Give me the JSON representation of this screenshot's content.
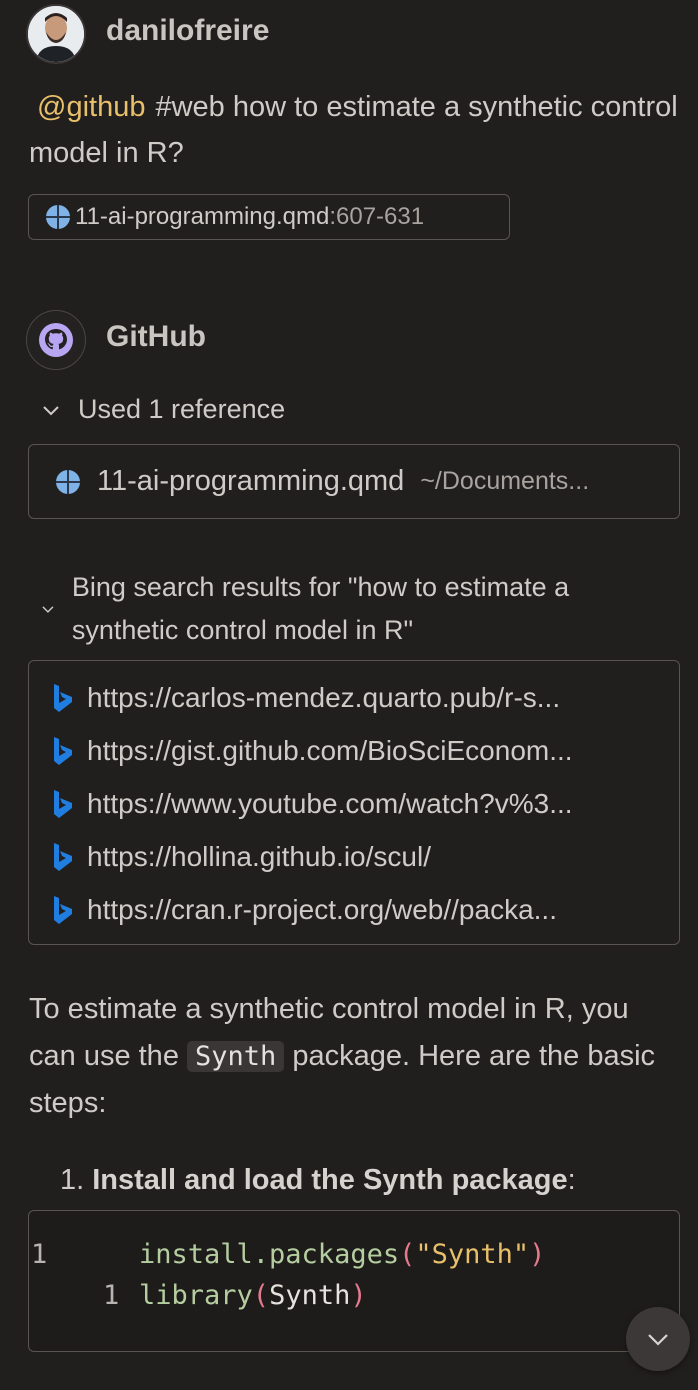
{
  "user": {
    "name": "danilofreire"
  },
  "prompt": {
    "mention": "@github",
    "text": "#web how to estimate a synthetic control model in R?"
  },
  "attachment": {
    "filename": "11-ai-programming.qmd",
    "range": ":607-631"
  },
  "response": {
    "agent_name": "GitHub",
    "references_toggle": "Used 1 reference",
    "reference": {
      "file": "11-ai-programming.qmd",
      "path": "~/Documents..."
    },
    "bing_toggle": "Bing search results for \"how to estimate a synthetic control model in R\"",
    "results": [
      "https://carlos-mendez.quarto.pub/r-s...",
      "https://gist.github.com/BioSciEconom...",
      "https://www.youtube.com/watch?v%3...",
      "https://hollina.github.io/scul/",
      "https://cran.r-project.org/web//packa..."
    ],
    "answer": {
      "before": "To estimate a synthetic control model in R, you can use the ",
      "code": "Synth",
      "after": " package. Here are the basic steps:"
    },
    "step1": {
      "number": "1.",
      "bold": "Install and load the Synth package",
      "suffix": ":"
    },
    "code": {
      "line1_no": "1",
      "line1_fn": "install.packages",
      "line1_open": "(",
      "line1_str": "\"Synth\"",
      "line1_close": ")",
      "line2_no": "1",
      "line2_fn": "library",
      "line2_open": "(",
      "line2_arg": "Synth",
      "line2_close": ")"
    }
  },
  "icons": {
    "attachment": "globe-icon",
    "agent": "github-icon",
    "result": "bing-icon",
    "scroll": "chevron-down-icon"
  },
  "colors": {
    "background": "#211e1e",
    "mention": "#e8bf6a",
    "border": "#59544f",
    "bing_blue": "#1f7ee0",
    "github_purple": "#b9a6f2",
    "code_function": "#b5cea0",
    "code_paren": "#e57a8e",
    "code_string": "#e8bf6a"
  }
}
